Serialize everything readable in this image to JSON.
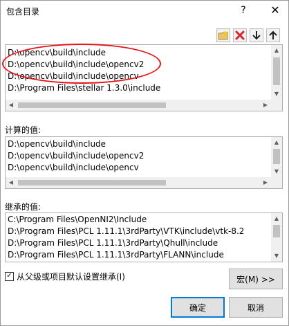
{
  "dialog": {
    "title": "包含目录",
    "help_label": "?",
    "close_label": "✕"
  },
  "toolbar": {
    "new_folder_icon": "new-folder-icon",
    "delete_icon": "delete-icon",
    "move_down_icon": "arrow-down-icon",
    "move_up_icon": "arrow-up-icon",
    "delete_color": "#d9232b"
  },
  "editable_list": {
    "items": [
      "D:\\opencv\\build\\include",
      "D:\\opencv\\build\\include\\opencv2",
      "D:\\opencv\\build\\include\\opencv",
      "D:\\Program Files\\stellar 1.3.0\\include"
    ]
  },
  "computed": {
    "label": "计算的值:",
    "items": [
      "D:\\opencv\\build\\include",
      "D:\\opencv\\build\\include\\opencv2",
      "D:\\opencv\\build\\include\\opencv"
    ]
  },
  "inherited": {
    "label": "继承的值:",
    "items": [
      "C:\\Program Files\\OpenNI2\\Include",
      "D:\\Program Files\\PCL 1.11.1\\3rdParty\\VTK\\include\\vtk-8.2",
      "D:\\Program Files\\PCL 1.11.1\\3rdParty\\Qhull\\include",
      "D:\\Program Files\\PCL 1.11.1\\3rdParty\\FLANN\\include"
    ]
  },
  "inherit_checkbox": {
    "label": "从父级或项目默认设置继承(I)",
    "checked": true,
    "check_glyph": "✓"
  },
  "buttons": {
    "macro": "宏(M) >>",
    "ok": "确定",
    "cancel": "取消"
  },
  "accent_color": "#0078d7",
  "annotation_color": "#e8131a"
}
